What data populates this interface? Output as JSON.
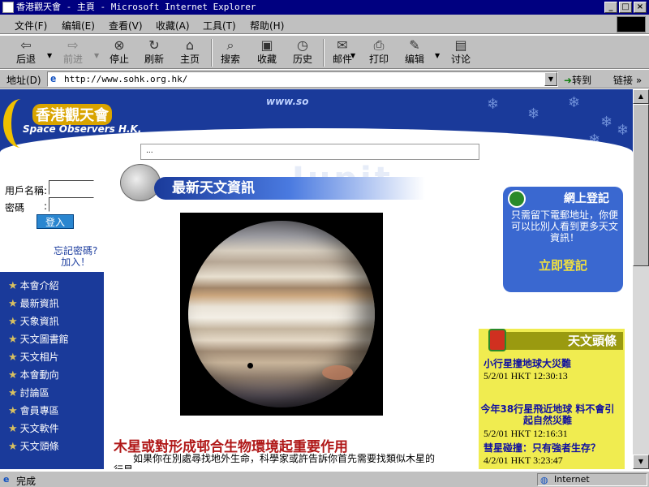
{
  "window": {
    "title": "香港觀天會 - 主頁 - Microsoft Internet Explorer",
    "minimize": "_",
    "maximize": "□",
    "close": "×"
  },
  "menu": [
    "文件(F)",
    "编辑(E)",
    "查看(V)",
    "收藏(A)",
    "工具(T)",
    "帮助(H)"
  ],
  "toolbar": {
    "back": "后退",
    "forward": "前进",
    "stop": "停止",
    "refresh": "刷新",
    "home": "主页",
    "search": "搜索",
    "favorites": "收藏",
    "history": "历史",
    "mail": "邮件",
    "print": "打印",
    "edit": "编辑",
    "discuss": "讨论"
  },
  "address": {
    "label": "地址(D)",
    "url": "http://www.sohk.org.hk/",
    "go": "转到",
    "links": "链接"
  },
  "page": {
    "logo_cn": "香港觀天會",
    "logo_en": "Space Observers H.K.",
    "www": "www.so",
    "search_hint": "...",
    "login": {
      "username_label": "用戶名稱:",
      "password_label": "密碼",
      "password_colon": ":",
      "login_button": "登入",
      "forgot": "忘記密碼?",
      "join": "加入！"
    },
    "nav": [
      "本會介紹",
      "最新資訊",
      "天象資訊",
      "天文圖書館",
      "天文相片",
      "本會動向",
      "討論區",
      "會員專區",
      "天文軟件",
      "天文頭條"
    ],
    "news_header": "最新天文資訊",
    "watermark": "Jupit",
    "headline": "木星或對形成邨合生物環境起重要作用",
    "lead": "如果你在別處尋找地外生命，科學家或許告訴你首先需要找類似木星的行星",
    "register": {
      "title": "網上登記",
      "text": "只需留下電郵地址，你便可以比別人看到更多天文資訊！",
      "button": "立即登記"
    },
    "headlines": {
      "title": "天文頭條",
      "items": [
        {
          "title": "小行星撞地球大災難",
          "time": "5/2/01 HKT 12:30:13"
        },
        {
          "title": "今年38行星飛近地球 料不會引起自然災難",
          "time": "5/2/01 HKT 12:16:31"
        },
        {
          "title": "彗星碰撞：只有強者生存？",
          "time": "4/2/01 HKT 3:23:47"
        }
      ]
    }
  },
  "status": {
    "text": "完成",
    "zone": "Internet"
  }
}
